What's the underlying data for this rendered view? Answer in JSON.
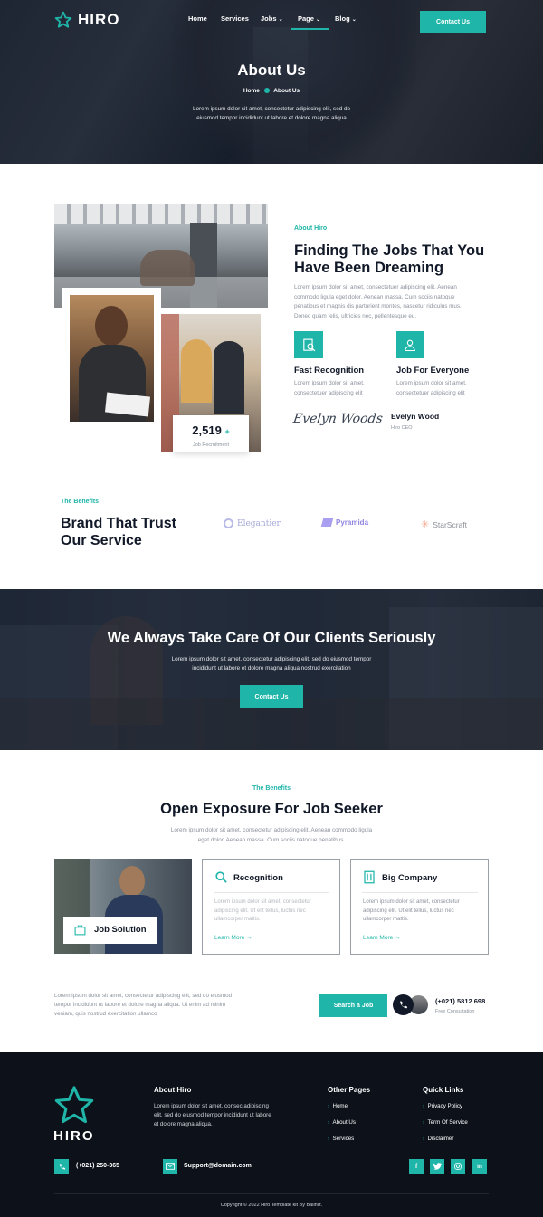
{
  "brand": "HIRO",
  "nav": {
    "items": [
      "Home",
      "Services",
      "Jobs",
      "Page",
      "Blog"
    ],
    "cta": "Contact Us"
  },
  "hero": {
    "title": "About Us",
    "crumb_home": "Home",
    "crumb_current": "About Us",
    "text_1": "Lorem ipsum dolor sit amet, consectetur adipiscing elit, sed do",
    "text_2": "eiusmod tempor incididunt ut labore et dolore magna aliqua"
  },
  "about": {
    "eyebrow": "About Hiro",
    "title_1": "Finding The Jobs That You",
    "title_2": "Have Been Dreaming",
    "para": [
      "Lorem ipsum dolor sit amet, consectetuer adipiscing elit. Aenean",
      "commodo ligula eget dolor. Aenean massa. Cum sociis natoque",
      "penatibus et magnis dis parturient montes, nascetur ridiculus mus.",
      "Donec quam felis, ultricies nec, pellentesque eu."
    ],
    "features": [
      {
        "title": "Fast Recognition",
        "line1": "Lorem ipsum dolor sit amet,",
        "line2": "consectetuer adipiscing elit"
      },
      {
        "title": "Job For Everyone",
        "line1": "Lorem ipsum dolor sit amet,",
        "line2": "consectetuer adipiscing elit"
      }
    ],
    "signature": "Evelyn Woods",
    "person_name": "Evelyn Wood",
    "person_role": "Hiro CEO",
    "stat_value": "2,519",
    "stat_plus": "+",
    "stat_label": "Job Recruitment"
  },
  "brands": {
    "eyebrow": "The Benefits",
    "title_1": "Brand That Trust",
    "title_2": "Our Service",
    "logos": [
      "Elegantier",
      "Pyramida",
      "StarScraft"
    ]
  },
  "banner": {
    "title": "We Always Take Care Of Our Clients Seriously",
    "text_1": "Lorem ipsum dolor sit amet, consectetur adipiscing elit, sed do eiusmod tempor",
    "text_2": "incididunt ut labore et dolore magna aliqua nostrud exercitation",
    "cta": "Contact Us"
  },
  "benefits": {
    "eyebrow": "The Benefits",
    "title": "Open Exposure For Job Seeker",
    "text_1": "Lorem ipsum dolor sit amet, consectetur adipiscing elit. Aenean commodo ligula",
    "text_2": "eget dolor. Aenean massa. Cum sociis natoque penatibus.",
    "photo_label": "Job Solution",
    "cards": [
      {
        "title": "Recognition",
        "l1": "Lorem ipsum dolor sit amet, consectetur",
        "l2": "adipiscing elit. Ut elit tellus, luctus nec",
        "l3": "ullamcorper mattis.",
        "link": "Learn More"
      },
      {
        "title": "Big Company",
        "l1": "Lorem ipsum dolor sit amet, consectetur",
        "l2": "adipiscing elit. Ut elit tellus, luctus nec",
        "l3": "ullamcorper mattis.",
        "link": "Learn More"
      }
    ]
  },
  "cta_row": {
    "l1": "Lorem ipsum dolor sit amet, consectetur adipiscing elit, sed do eiusmod",
    "l2": "tempor incididunt ut labore et dolore magna aliqua. Ut enim ad minim",
    "l3": "veniam, quis nostrud exercitation ullamco",
    "button": "Search a Job",
    "phone": "(+021) 5812 698",
    "phone_note": "Free Consultation"
  },
  "footer": {
    "brand": "HIRO",
    "about_title": "About Hiro",
    "about_1": "Lorem ipsum dolor sit amet, consec adipiscing",
    "about_2": "elit, sed do eiusmod tempor incididunt ut labore",
    "about_3": "et dolore magna aliqua.",
    "other_title": "Other Pages",
    "other": [
      "Home",
      "About Us",
      "Services"
    ],
    "quick_title": "Quick Links",
    "quick": [
      "Privacy Policy",
      "Term Of Service",
      "Disclaimer"
    ],
    "phone": "(+021) 250-365",
    "email": "Support@domain.com",
    "copyright": "Copyright © 2022 Hiro Template kit By Baliniz.",
    "social": [
      "f",
      "t",
      "ig",
      "in"
    ]
  },
  "colors": {
    "accent": "#1fb5a8",
    "dark": "#0d121a"
  }
}
